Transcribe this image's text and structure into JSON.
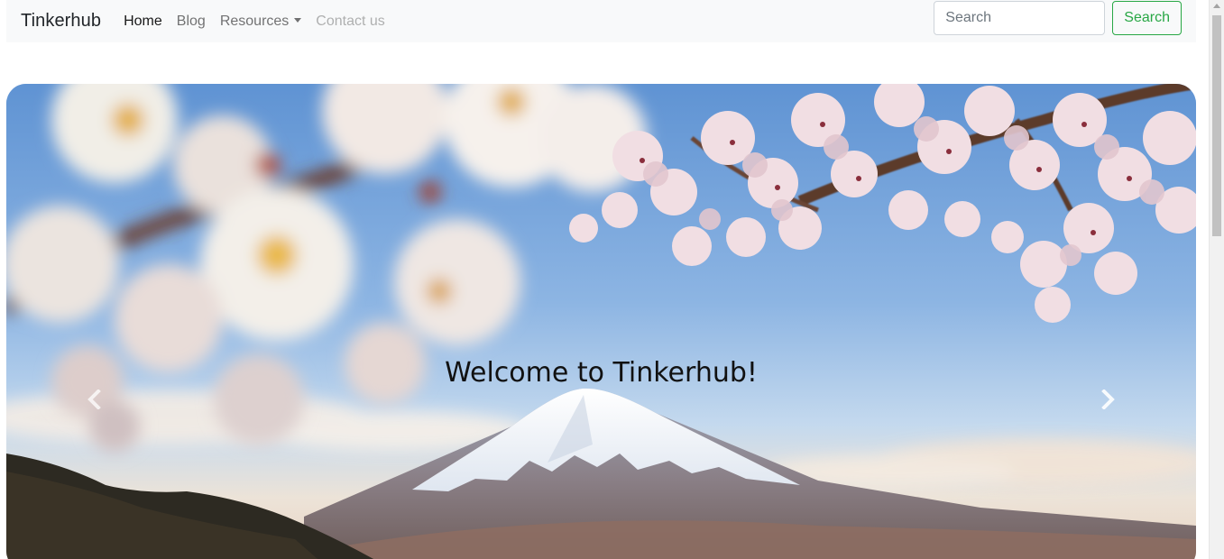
{
  "navbar": {
    "brand": "Tinkerhub",
    "links": [
      {
        "label": "Home",
        "state": "active"
      },
      {
        "label": "Blog",
        "state": "normal"
      },
      {
        "label": "Resources",
        "state": "dropdown"
      },
      {
        "label": "Contact us",
        "state": "disabled"
      }
    ],
    "search": {
      "placeholder": "Search",
      "value": "",
      "button_label": "Search"
    }
  },
  "carousel": {
    "caption": "Welcome to Tinkerhub!",
    "prev_icon": "chevron-left-icon",
    "next_icon": "chevron-right-icon",
    "scene": "cherry-blossoms-and-snow-capped-mountain"
  },
  "colors": {
    "navbar_bg": "#f8f9fa",
    "success": "#28a745",
    "sky": "#8fb6e4",
    "blossom": "#f3e3e6"
  }
}
